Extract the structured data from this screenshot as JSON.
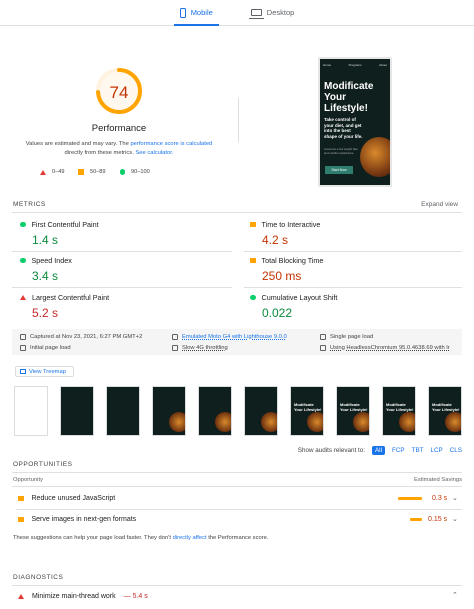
{
  "tabs": [
    {
      "label": "Mobile"
    },
    {
      "label": "Desktop"
    }
  ],
  "score": {
    "value": "74",
    "title": "Performance",
    "fraction": 0.74,
    "color": "#ffa400"
  },
  "note": {
    "t1": "Values are estimated and may vary. The ",
    "l1": "performance score is calculated",
    "t2": "directly from these metrics. ",
    "l2": "See calculator."
  },
  "legend": [
    "0–49",
    "50–89",
    "90–100"
  ],
  "phone": {
    "nav1": "Home",
    "nav2": "Programs",
    "nav3": "About",
    "headline": "Modificate Your Lifestyle!",
    "pitch": "Take control of your diet, and get into the best shape of your life.",
    "small": "Consume a low weight diet, and nutrition assistance",
    "button": "Start Now"
  },
  "metrics_title": "METRICS",
  "expand": "Expand view",
  "metrics": [
    {
      "label": "First Contentful Paint",
      "value": "1.4 s"
    },
    {
      "label": "Time to Interactive",
      "value": "4.2 s"
    },
    {
      "label": "Speed Index",
      "value": "3.4 s"
    },
    {
      "label": "Total Blocking Time",
      "value": "250 ms"
    },
    {
      "label": "Largest Contentful Paint",
      "value": "5.2 s"
    },
    {
      "label": "Cumulative Layout Shift",
      "value": "0.022"
    }
  ],
  "info": [
    "Captured at Nov 23, 2021, 6:27 PM GMT+2",
    "Emulated Moto G4 with Lighthouse 9.0.0",
    "Single page load",
    "Initial page load",
    "Slow 4G throttling",
    "Using HeadlessChromium 95.0.4638.69 with lr"
  ],
  "treemap": "View Treemap",
  "frame_text": "Modificate Your Lifestyle!",
  "relevant": {
    "label": "Show audits relevant to:",
    "chips": [
      "All",
      "FCP",
      "TBT",
      "LCP",
      "CLS"
    ]
  },
  "opportunities": {
    "title": "OPPORTUNITIES",
    "col1": "Opportunity",
    "col2": "Estimated Savings",
    "items": [
      {
        "label": "Reduce unused JavaScript",
        "saving": "0.3 s",
        "fraction": 1.0
      },
      {
        "label": "Serve images in next-gen formats",
        "saving": "0.15 s",
        "fraction": 0.5
      }
    ]
  },
  "note_text": {
    "t1": "These suggestions can help your page load faster. They don't ",
    "link": "directly affect",
    "t2": " the Performance score."
  },
  "diagnostics": {
    "title": "DIAGNOSTICS",
    "item": "Minimize main-thread work",
    "value": "— 5.4 s"
  }
}
